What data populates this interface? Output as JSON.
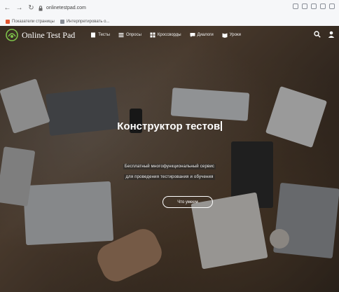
{
  "browser": {
    "url": "onlinetestpad.com",
    "bookmarks": [
      {
        "label": "Показатели страницы",
        "color": "#e2542f"
      },
      {
        "label": "Интерпретировать о...",
        "color": "#8a8f98"
      }
    ]
  },
  "site": {
    "brand": "Online Test Pad",
    "menu": [
      {
        "label": "Тесты",
        "icon": "document-icon"
      },
      {
        "label": "Опросы",
        "icon": "list-icon"
      },
      {
        "label": "Кроссворды",
        "icon": "grid-icon"
      },
      {
        "label": "Диалоги",
        "icon": "chat-icon"
      },
      {
        "label": "Уроки",
        "icon": "book-icon"
      }
    ]
  },
  "hero": {
    "headline": "Конструктор тестов",
    "subtitle_line1": "Бесплатный многофункциональный сервис",
    "subtitle_line2": "для проведения тестирования и обучения",
    "cta": "Что умеем"
  }
}
